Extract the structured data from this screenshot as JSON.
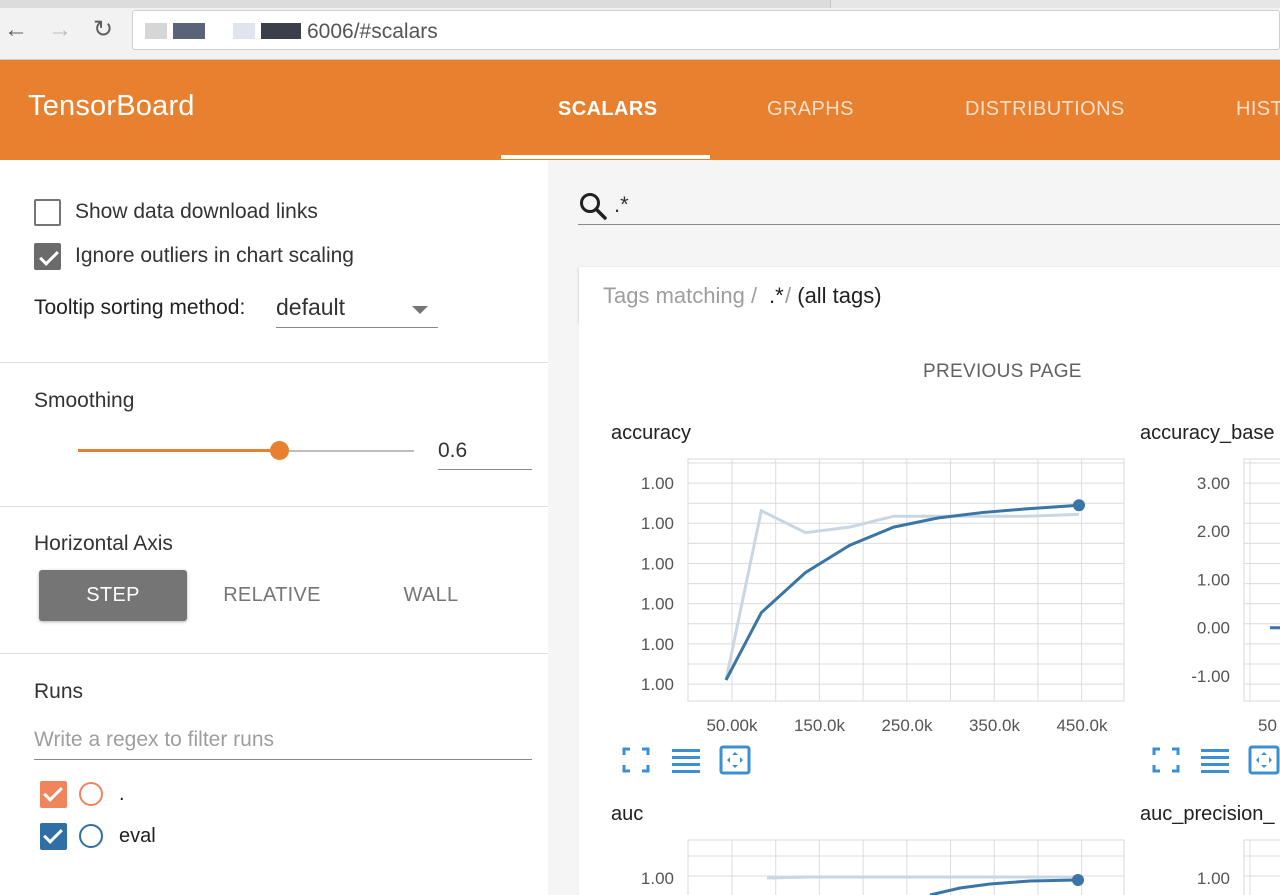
{
  "browser": {
    "url_visible": "6006/#scalars"
  },
  "header": {
    "title": "TensorBoard",
    "tabs": [
      {
        "label": "SCALARS",
        "active": true
      },
      {
        "label": "GRAPHS",
        "active": false
      },
      {
        "label": "DISTRIBUTIONS",
        "active": false
      },
      {
        "label": "HIST",
        "active": false
      }
    ],
    "accent_color": "#e8812f"
  },
  "sidebar": {
    "show_download_links": {
      "label": "Show data download links",
      "checked": false
    },
    "ignore_outliers": {
      "label": "Ignore outliers in chart scaling",
      "checked": true
    },
    "tooltip_sorting": {
      "label": "Tooltip sorting method:",
      "value": "default"
    },
    "smoothing": {
      "title": "Smoothing",
      "value": "0.6",
      "fraction": 0.6
    },
    "horizontal_axis": {
      "title": "Horizontal Axis",
      "options": [
        {
          "label": "STEP",
          "active": true
        },
        {
          "label": "RELATIVE",
          "active": false
        },
        {
          "label": "WALL",
          "active": false
        }
      ]
    },
    "runs": {
      "title": "Runs",
      "filter_placeholder": "Write a regex to filter runs",
      "items": [
        {
          "name": ".",
          "checked": true,
          "color": "#f0845c"
        },
        {
          "name": "eval",
          "checked": true,
          "color": "#2f6fa6"
        }
      ]
    }
  },
  "main": {
    "search_value": ".*",
    "tags_matching": {
      "prefix": "Tags matching /",
      "pattern": ".*",
      "suffix": "/ (all tags)"
    },
    "previous_page": "PREVIOUS PAGE",
    "charts": [
      {
        "title": "accuracy"
      },
      {
        "title": "accuracy_base"
      },
      {
        "title": "auc"
      },
      {
        "title": "auc_precision_"
      }
    ]
  },
  "chart_data": [
    {
      "type": "line",
      "title": "accuracy",
      "x_tick_labels": [
        "50.00k",
        "150.0k",
        "250.0k",
        "350.0k",
        "450.0k"
      ],
      "y_tick_labels": [
        "1.00",
        "1.00",
        "1.00",
        "1.00",
        "1.00",
        "1.00"
      ],
      "series": [
        {
          "style": "raw",
          "color": "#c9d6e3",
          "x": [
            50000,
            90000,
            140000,
            190000,
            240000,
            290000,
            340000,
            390000,
            450000
          ],
          "y": [
            0,
            0.93,
            0.81,
            0.84,
            0.9,
            0.9,
            0.9,
            0.9,
            0.91
          ]
        },
        {
          "style": "smoothed",
          "color": "#3b75a5",
          "x": [
            50000,
            90000,
            140000,
            190000,
            240000,
            290000,
            340000,
            390000,
            450000
          ],
          "y": [
            0,
            0.37,
            0.59,
            0.74,
            0.84,
            0.89,
            0.92,
            0.94,
            0.96
          ]
        }
      ]
    },
    {
      "type": "line",
      "title": "accuracy_base",
      "x_tick_labels": [
        "50"
      ],
      "y_tick_labels": [
        "3.00",
        "2.00",
        "1.00",
        "0.00",
        "-1.00"
      ],
      "ylim": [
        -1,
        3
      ],
      "series": [
        {
          "style": "smoothed",
          "color": "#3b75a5",
          "x": [
            50000
          ],
          "y": [
            0.0
          ]
        }
      ]
    },
    {
      "type": "line",
      "title": "auc",
      "y_tick_labels": [
        "1.00"
      ]
    },
    {
      "type": "line",
      "title": "auc_precision_",
      "y_tick_labels": [
        "1.00"
      ]
    }
  ]
}
